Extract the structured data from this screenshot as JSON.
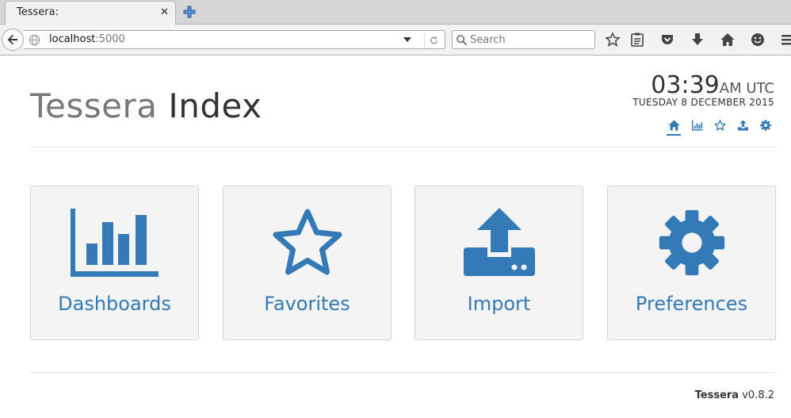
{
  "browser": {
    "tab_title": "Tessera:",
    "tab_close": "✕",
    "url_host": "localhost",
    "url_port": ":5000",
    "search_placeholder": "Search"
  },
  "header": {
    "brand": "Tessera",
    "section": "Index",
    "time": "03:39",
    "time_suffix": "AM UTC",
    "date": "TUESDAY 8 DECEMBER 2015",
    "nav_icons": [
      "home-icon",
      "bar-chart-icon",
      "star-icon",
      "upload-icon",
      "gear-icon"
    ],
    "active_nav": "home-icon"
  },
  "tiles": [
    {
      "label": "Dashboards",
      "icon": "bar-chart-icon"
    },
    {
      "label": "Favorites",
      "icon": "star-icon"
    },
    {
      "label": "Import",
      "icon": "upload-icon"
    },
    {
      "label": "Preferences",
      "icon": "gear-icon"
    }
  ],
  "footer": {
    "app_name": "Tessera",
    "version": "v0.8.2"
  },
  "colors": {
    "accent": "#337ab7",
    "tile_bg": "#f4f4f4",
    "tile_border": "#d4d4d4",
    "brand_gray": "#777777",
    "title_dark": "#333333"
  }
}
